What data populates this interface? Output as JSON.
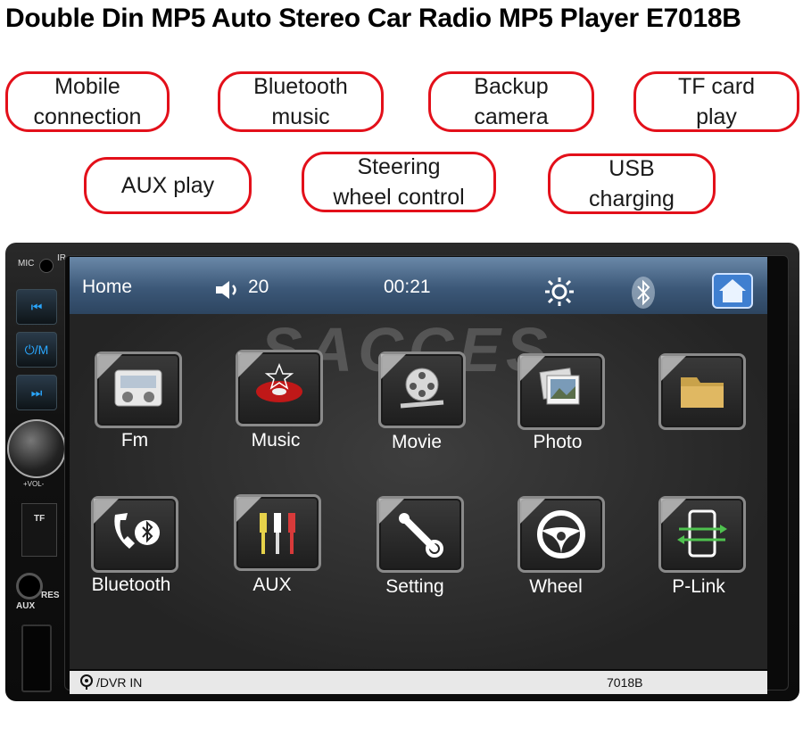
{
  "title": "Double Din MP5 Auto Stereo Car Radio MP5 Player E7018B",
  "features": [
    [
      "Mobile",
      "connection"
    ],
    [
      "Bluetooth",
      "music"
    ],
    [
      "Backup",
      "camera"
    ],
    [
      "TF card",
      "play"
    ],
    [
      "AUX play"
    ],
    [
      "Steering",
      "wheel control"
    ],
    [
      "USB",
      "charging"
    ]
  ],
  "device": {
    "mic_label": "MIC",
    "ir_label": "IR",
    "prev_label": "⏮",
    "power_mode_label": "⏻/M",
    "next_label": "⏭",
    "vol_label": "+VOL-",
    "tf_label": "TF",
    "aux_label": "AUX",
    "res_label": "RES",
    "model": "7018B",
    "dvr_label": "/DVR IN",
    "watermark": "SACCES"
  },
  "statusbar": {
    "home": "Home",
    "volume": "20",
    "time": "00:21"
  },
  "apps": [
    {
      "label": "Fm",
      "icon": "radio-icon"
    },
    {
      "label": "Music",
      "icon": "music-disc-icon"
    },
    {
      "label": "Movie",
      "icon": "film-reel-icon"
    },
    {
      "label": "Photo",
      "icon": "photo-stack-icon"
    },
    {
      "label": "",
      "icon": "folder-icon"
    },
    {
      "label": "Bluetooth",
      "icon": "bluetooth-phone-icon"
    },
    {
      "label": "AUX",
      "icon": "rca-cable-icon"
    },
    {
      "label": "Setting",
      "icon": "wrench-icon"
    },
    {
      "label": "Wheel",
      "icon": "steering-wheel-icon"
    },
    {
      "label": "P-Link",
      "icon": "phone-link-icon"
    }
  ],
  "colors": {
    "accent": "#e3101a",
    "statusbar": "#3c5878",
    "button_text": "#2aa7ff"
  }
}
